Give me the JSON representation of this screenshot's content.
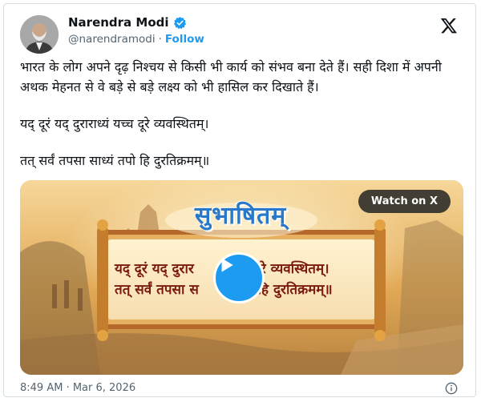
{
  "author": {
    "name": "Narendra Modi",
    "handle": "@narendramodi",
    "separator": "·",
    "follow_label": "Follow",
    "verified_color": "#1d9bf0"
  },
  "tweet": {
    "paragraph1": "भारत के लोग अपने दृढ़ निश्चय से किसी भी कार्य को संभव बना देते हैं। सही दिशा में अपनी अथक मेहनत से वे बड़े से बड़े लक्ष्य को भी हासिल कर दिखाते हैं।",
    "paragraph2": "यद् दूरं यद् दुराराध्यं यच्च दूरे व्यवस्थितम्।",
    "paragraph3": "तत् सर्वं तपसा साध्यं तपो हि दुरतिक्रमम्॥"
  },
  "media": {
    "watch_label": "Watch on X",
    "title": "सुभाषितम्",
    "verse_line1": "यद् दूरं यद् दुरार",
    "verse_line1_end": "दूरे व्यवस्थितम्।",
    "verse_line2": "तत् सर्वं तपसा स",
    "verse_line2_end": "हि दुरतिक्रमम्॥"
  },
  "footer": {
    "timestamp": "8:49 AM · Mar 6, 2026"
  },
  "icons": {
    "verified": "verified-badge-icon",
    "x_logo": "x-logo-icon",
    "play": "play-icon",
    "info": "info-icon"
  },
  "colors": {
    "accent": "#1d9bf0",
    "text": "#0f1419",
    "muted": "#536471"
  }
}
